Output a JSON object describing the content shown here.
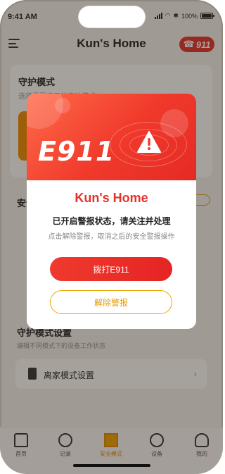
{
  "status_bar": {
    "time": "9:41 AM",
    "battery": "100%",
    "battery_level": 1.0
  },
  "header": {
    "title": "Kun's Home",
    "badge_label": "911"
  },
  "background": {
    "guard_card_title": "守护模式",
    "guard_card_subtitle": "选择需要应用的守护模式",
    "security_section_title": "安全",
    "guard_settings_title": "守护模式设置",
    "guard_settings_subtitle": "编辑不同模式下的设备工作状态",
    "away_mode_label": "离家模式设置"
  },
  "modal": {
    "banner_text": "E911",
    "title": "Kun's Home",
    "message": "已开启警报状态，请关注并处理",
    "hint": "点击解除警报，取消之后的安全警报操作",
    "dial_button": "拨打E911",
    "dismiss_button": "解除警报"
  },
  "tabbar": {
    "items": [
      {
        "label": "首页",
        "icon": "home-icon"
      },
      {
        "label": "记录",
        "icon": "record-icon"
      },
      {
        "label": "安全模式",
        "icon": "shield-icon",
        "active": true
      },
      {
        "label": "设备",
        "icon": "camera-icon"
      },
      {
        "label": "我的",
        "icon": "user-icon"
      }
    ]
  },
  "colors": {
    "alert_red": "#e5312a",
    "accent_orange": "#f0a300"
  }
}
